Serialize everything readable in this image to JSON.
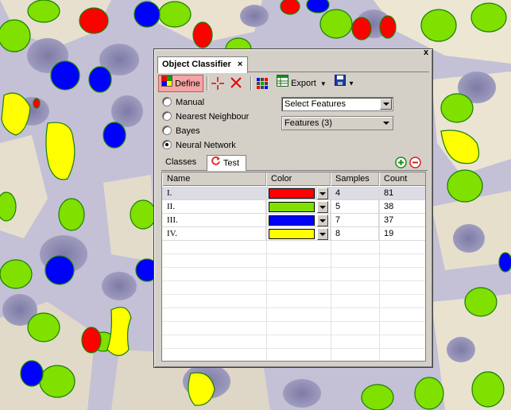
{
  "panel": {
    "title": "Object Classifier",
    "close_glyph": "x",
    "toolbar": {
      "define_label": "Define",
      "export_label": "Export"
    },
    "methods": [
      {
        "label": "Manual",
        "selected": false
      },
      {
        "label": "Nearest Neighbour",
        "selected": false
      },
      {
        "label": "Bayes",
        "selected": false
      },
      {
        "label": "Neural Network",
        "selected": true
      }
    ],
    "select_features": "Select Features",
    "features_label": "Features (3)",
    "tabs": {
      "classes": "Classes",
      "test": "Test"
    },
    "table": {
      "headers": [
        "Name",
        "Color",
        "Samples",
        "Count"
      ],
      "rows": [
        {
          "name": "I.",
          "color": "#ff0000",
          "samples": "4",
          "count": "81"
        },
        {
          "name": "II.",
          "color": "#80e000",
          "samples": "5",
          "count": "38"
        },
        {
          "name": "III.",
          "color": "#0000ff",
          "samples": "7",
          "count": "37"
        },
        {
          "name": "IV.",
          "color": "#ffff00",
          "samples": "8",
          "count": "19"
        }
      ]
    }
  },
  "icons": {
    "define": "palette-icon",
    "add_point": "crosshair-icon",
    "delete": "red-x-icon",
    "classify": "grid-dots-icon",
    "export": "spreadsheet-icon",
    "save": "floppy-icon",
    "refresh": "refresh-icon",
    "add_class": "green-plus-icon",
    "remove_class": "red-minus-icon"
  }
}
